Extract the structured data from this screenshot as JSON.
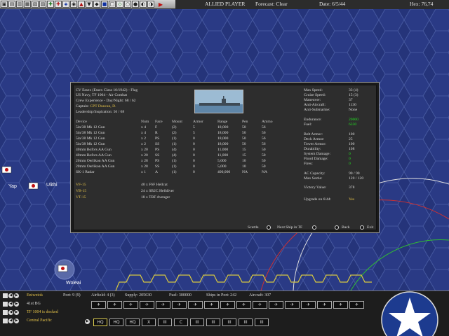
{
  "topbar": {
    "tool_icons": [
      "icon",
      "icon",
      "icon",
      "icon",
      "icon",
      "icon",
      "icon",
      "icon",
      "icon",
      "icon",
      "icon",
      "icon",
      "icon",
      "icon",
      "icon",
      "icon",
      "icon",
      "icon",
      "icon",
      "icon"
    ],
    "player": "ALLIED PLAYER",
    "weather": "Forecast: Clear",
    "date": "Date: 6/5/44",
    "turn": "Hex: 76,74"
  },
  "map": {
    "hex_fill": "#2a3a85",
    "hex_stroke": "#3f52a8",
    "bases": [
      {
        "label": "Yap"
      },
      {
        "label": "Ulithi"
      },
      {
        "label": "Woleai"
      }
    ]
  },
  "ship": {
    "header_lines": [
      "CV Essex (Essex Class 10/1942) - Flag",
      "US Navy, TF 1004 - Air Combat",
      "Crew Experience - Day/Night: 68 / 62",
      "Captain: ",
      "Leadership/Inspiration: 56 / 68"
    ],
    "captain_name": "CPT Duncan, D.",
    "stats_left": [
      {
        "label": "Max Speed:",
        "value": "33 (4)"
      },
      {
        "label": "Cruise Speed:",
        "value": "15 (3)"
      },
      {
        "label": "Maneuver:",
        "value": "37"
      },
      {
        "label": "Anti-Aircraft:",
        "value": "1130"
      },
      {
        "label": "Anti-Submarine:",
        "value": "None"
      }
    ],
    "endurance": {
      "label": "Endurance:",
      "value": "20000"
    },
    "fuel": {
      "label": "Fuel:",
      "value": "6330"
    },
    "stats_mid": [
      {
        "label": "Belt Armor:",
        "value": "100",
        "green": false
      },
      {
        "label": "Deck Armor:",
        "value": "25",
        "green": false
      },
      {
        "label": "Tower Armor:",
        "value": "100",
        "green": false
      },
      {
        "label": "Durability:",
        "value": "108",
        "green": false
      },
      {
        "label": "System Damage:",
        "value": "0",
        "green": true
      },
      {
        "label": "Flood Damage:",
        "value": "0",
        "green": true
      },
      {
        "label": "Fires:",
        "value": "0",
        "green": true
      }
    ],
    "stats_air": [
      {
        "label": "AC Capacity:",
        "value": "90 / 90"
      },
      {
        "label": "Max Sortie:",
        "value": "120 / 120"
      }
    ],
    "victory": {
      "label": "Victory Value:",
      "value": "378"
    },
    "upgrade": {
      "label": "Upgrade on 6/44:",
      "value": "Yes"
    },
    "weapon_headers": [
      "Device",
      "Num",
      "Face",
      "Mount",
      "Armor",
      "Range",
      "Pen",
      "Ammo"
    ],
    "weapons": [
      [
        "5in/38 Mk 12 Gun",
        "x 4",
        "F",
        "(2)",
        "5",
        "18,000",
        "50",
        "56"
      ],
      [
        "5in/38 Mk 12 Gun",
        "x 4",
        "R",
        "(2)",
        "5",
        "18,000",
        "50",
        "56"
      ],
      [
        "5in/38 Mk 12 Gun",
        "x 2",
        "PS",
        "(1)",
        "0",
        "18,000",
        "50",
        "56"
      ],
      [
        "5in/38 Mk 12 Gun",
        "x 2",
        "SS",
        "(1)",
        "0",
        "18,000",
        "50",
        "56"
      ],
      [
        "40mm Bofors AA Gun",
        "x 20",
        "PS",
        "(4)",
        "0",
        "11,000",
        "15",
        "50"
      ],
      [
        "40mm Bofors AA Gun",
        "x 20",
        "SS",
        "(4)",
        "0",
        "11,000",
        "15",
        "50"
      ],
      [
        "20mm Oerlikon AA Gun",
        "x 28",
        "PS",
        "(1)",
        "0",
        "5,000",
        "10",
        "50"
      ],
      [
        "20mm Oerlikon AA Gun",
        "x 28",
        "SS",
        "(1)",
        "0",
        "5,000",
        "10",
        "50"
      ],
      [
        "SK-1 Radar",
        "x 1",
        "A",
        "(1)",
        "0",
        "400,000",
        "NA",
        "NA"
      ]
    ],
    "air_groups": [
      {
        "name": "VF-15",
        "desc": "40 x F6F Hellcat"
      },
      {
        "name": "VB-15",
        "desc": "24 x SB2C Helldiver"
      },
      {
        "name": "VT-15",
        "desc": "18 x TBF Avenger"
      }
    ],
    "nav": {
      "scuttle": "Scuttle",
      "next_ship": "Next Ship in TF",
      "back": "Back",
      "exit": "Exit"
    }
  },
  "bottom": {
    "rows": [
      {
        "name": "Eniwetok",
        "color": "yellow"
      },
      {
        "name": "41st BG",
        "color": "white"
      },
      {
        "name": "TF 1004 is docked",
        "color": "yellow"
      },
      {
        "name": "Central Pacific",
        "color": "yellow"
      }
    ],
    "port": "Port: 9 (9)",
    "airfield": "Airfield: 4 (3)",
    "supply": "Supply: 205630",
    "fuel": "Fuel: 300000",
    "ships_in_port": "Ships in Port: 242",
    "aircraft": "Aircraft: 307",
    "air_slots": [
      "icon",
      "icon",
      "icon",
      "icon",
      "icon",
      "icon",
      "icon",
      "icon",
      "icon",
      "icon",
      "icon",
      "icon",
      "icon",
      "icon",
      "icon",
      "icon",
      "icon"
    ],
    "unit_slots": [
      "HQ",
      "HQ",
      "HQ",
      "X",
      "III",
      "C",
      "III",
      "III",
      "III",
      "III",
      "III"
    ],
    "accent": "#e6c44a"
  }
}
